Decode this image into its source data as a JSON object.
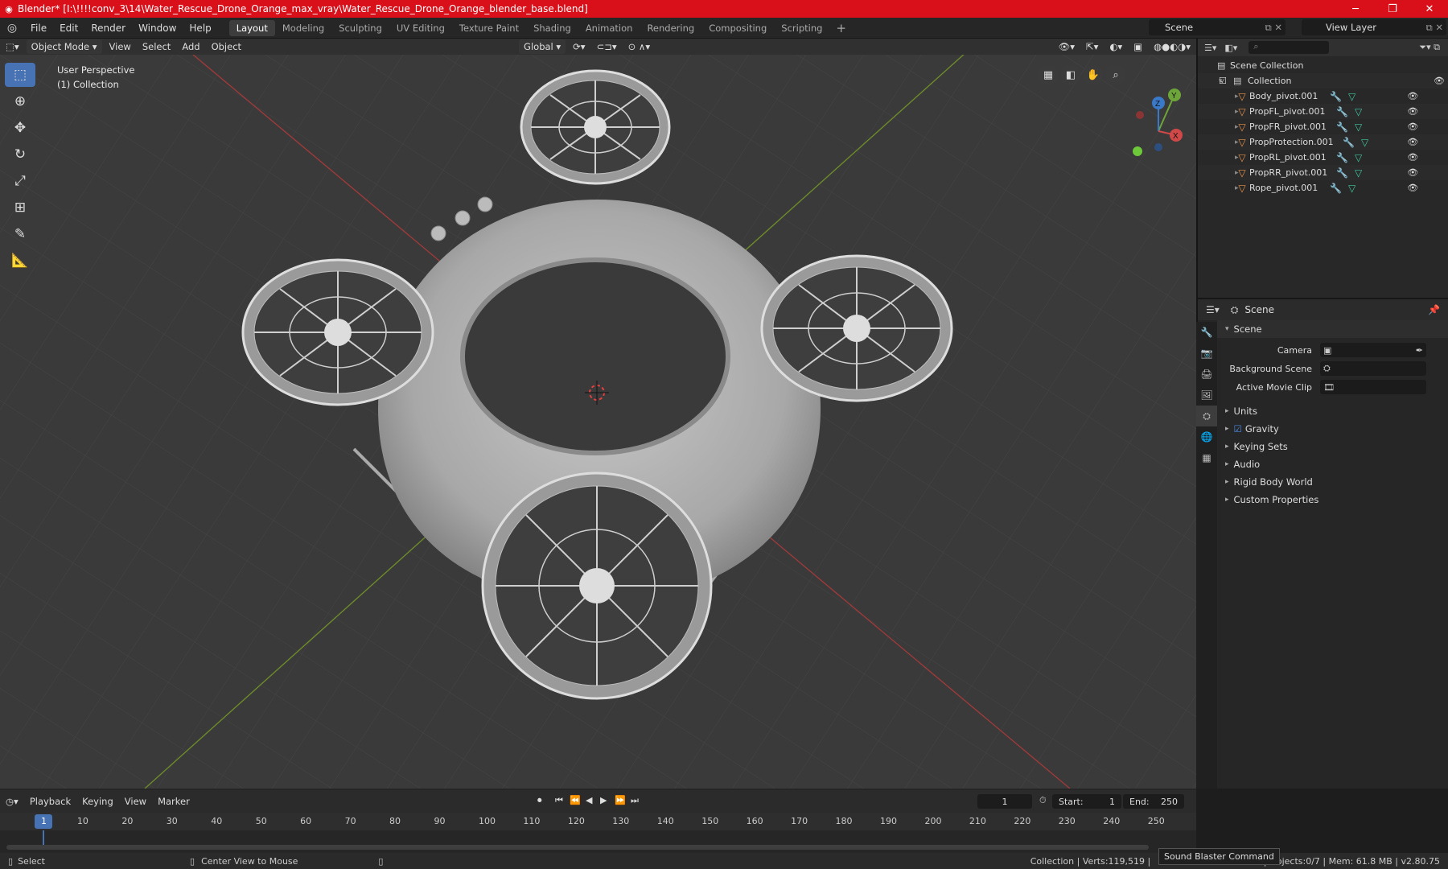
{
  "window": {
    "title": "Blender* [I:\\!!!!conv_3\\14\\Water_Rescue_Drone_Orange_max_vray\\Water_Rescue_Drone_Orange_blender_base.blend]",
    "minimize": "─",
    "maximize": "❐",
    "close": "✕"
  },
  "menu": [
    "File",
    "Edit",
    "Render",
    "Window",
    "Help"
  ],
  "workspaces": [
    "Layout",
    "Modeling",
    "Sculpting",
    "UV Editing",
    "Texture Paint",
    "Shading",
    "Animation",
    "Rendering",
    "Compositing",
    "Scripting"
  ],
  "workspace_add": "+",
  "scene_name": "Scene",
  "view_layer": "View Layer",
  "viewport_header": {
    "mode": "Object Mode",
    "menus": [
      "View",
      "Select",
      "Add",
      "Object"
    ],
    "transform": "Global"
  },
  "viewport": {
    "perspective": "User Perspective",
    "collection": "(1) Collection"
  },
  "gizmo": {
    "z": "Z",
    "y": "Y",
    "x": "X"
  },
  "outliner": {
    "root": "Scene Collection",
    "collection": "Collection",
    "objects": [
      "Body_pivot.001",
      "PropFL_pivot.001",
      "PropFR_pivot.001",
      "PropProtection.001",
      "PropRL_pivot.001",
      "PropRR_pivot.001",
      "Rope_pivot.001"
    ]
  },
  "properties": {
    "header": "Scene",
    "panel": "Scene",
    "camera_label": "Camera",
    "background_label": "Background Scene",
    "movieclip_label": "Active Movie Clip",
    "sections": [
      "Units",
      "Gravity",
      "Keying Sets",
      "Audio",
      "Rigid Body World",
      "Custom Properties"
    ]
  },
  "timeline": {
    "menus": [
      "Playback",
      "Keying",
      "View",
      "Marker"
    ],
    "current_frame": "1",
    "start_label": "Start:",
    "start": "1",
    "end_label": "End:",
    "end": "250",
    "ticks": [
      "1",
      "10",
      "20",
      "30",
      "40",
      "50",
      "60",
      "70",
      "80",
      "90",
      "100",
      "110",
      "120",
      "130",
      "140",
      "150",
      "160",
      "170",
      "180",
      "190",
      "200",
      "210",
      "220",
      "230",
      "240",
      "250"
    ]
  },
  "status": {
    "select": "Select",
    "center": "Center View to Mouse",
    "stats_left": "Collection | Verts:119,519 |",
    "stats_right": "4 | Objects:0/7 | Mem: 61.8 MB | v2.80.75",
    "tooltip": "Sound Blaster Command"
  }
}
